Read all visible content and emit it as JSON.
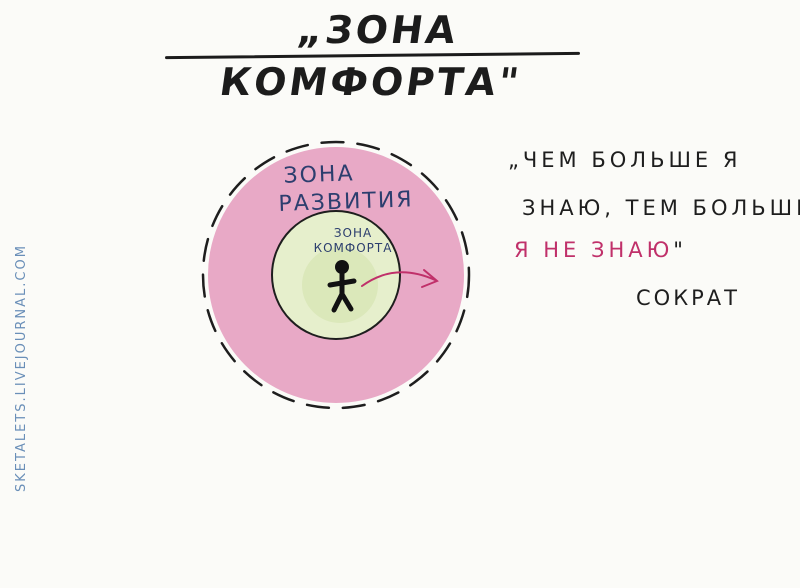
{
  "title": "„ЗОНА КОМФОРТА\"",
  "diagram": {
    "outer_zone_label": [
      "ЗОНА",
      "РАЗВИТИЯ"
    ],
    "inner_zone_label": [
      "ЗОНА",
      "КОМФОРТА"
    ],
    "colors": {
      "outer_zone": "#e8a9c6",
      "inner_zone": "#e6efcc",
      "arrow": "#c0306a",
      "person": "#111111"
    },
    "icons": [
      "stick-figure-icon",
      "arrow-right-icon"
    ]
  },
  "quote": {
    "line1": "„ЧЕМ БОЛЬШЕ Я",
    "line2": "ЗНАЮ, ТЕМ БОЛЬШЕ",
    "line3": "Я НЕ ЗНАЮ",
    "closing_mark": "\"",
    "author": "СОКРАТ",
    "highlight_color": "#c0306a"
  },
  "watermark": "SKETALETS.LIVEJOURNAL.COM"
}
